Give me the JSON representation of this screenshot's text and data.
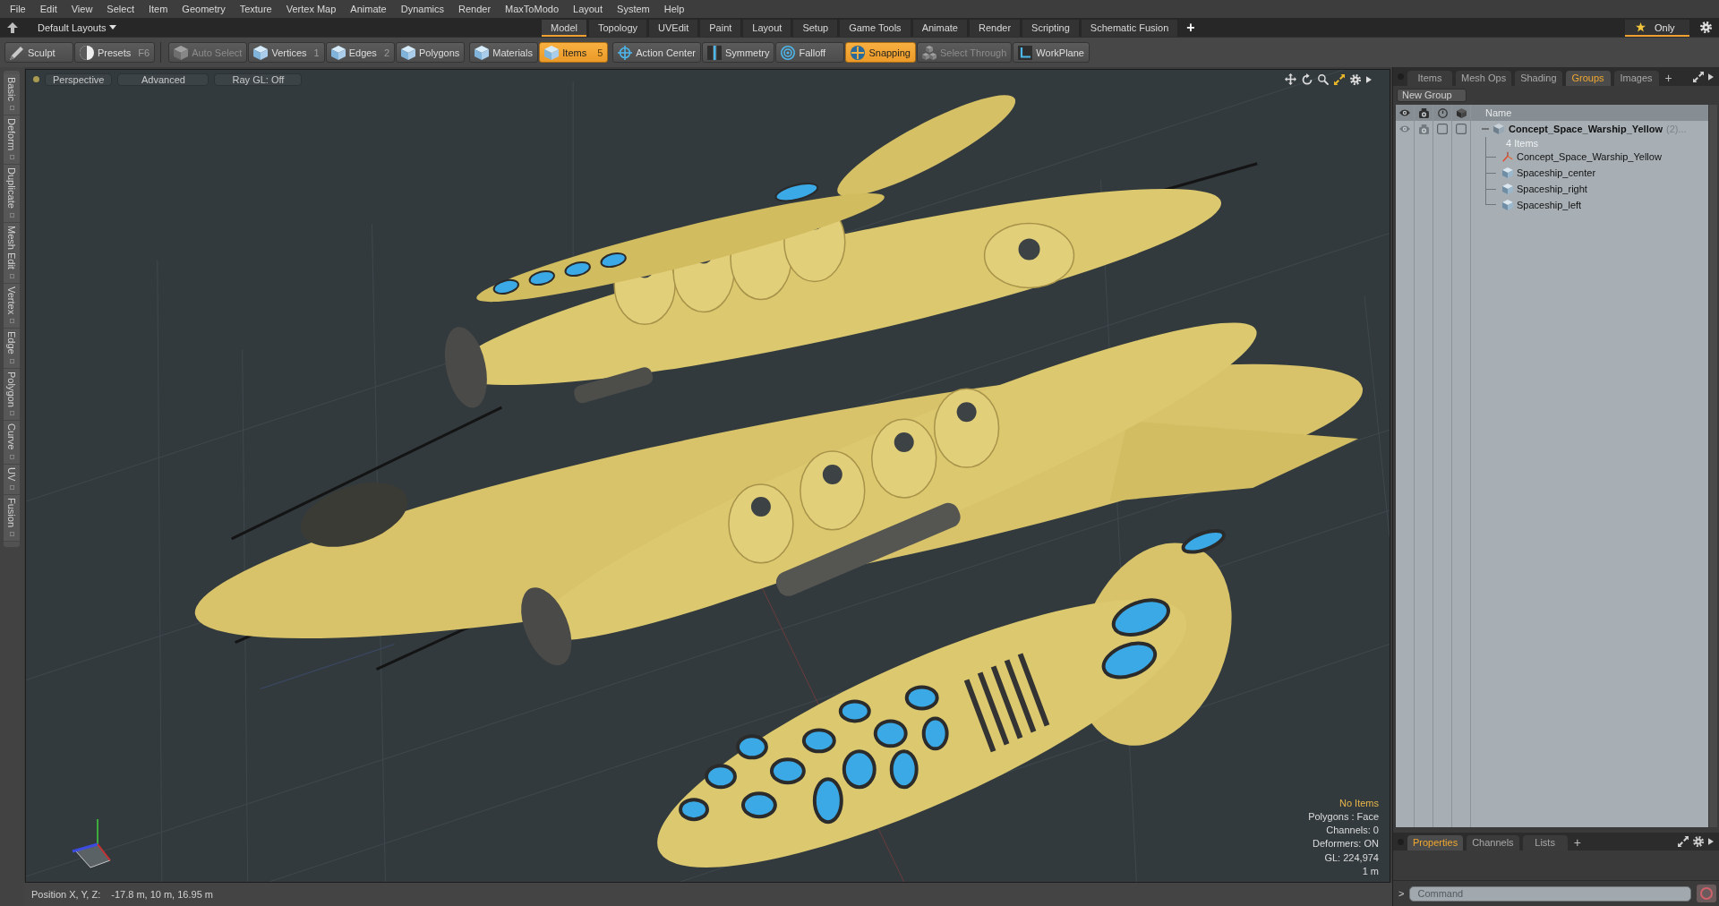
{
  "menu_bar": {
    "items": [
      "File",
      "Edit",
      "View",
      "Select",
      "Item",
      "Geometry",
      "Texture",
      "Vertex Map",
      "Animate",
      "Dynamics",
      "Render",
      "MaxToModo",
      "Layout",
      "System",
      "Help"
    ]
  },
  "layout_bar": {
    "layout_menu": "Default Layouts",
    "tabs": [
      {
        "label": "Model",
        "selected": true
      },
      {
        "label": "Topology",
        "selected": false
      },
      {
        "label": "UVEdit",
        "selected": false
      },
      {
        "label": "Paint",
        "selected": false
      },
      {
        "label": "Layout",
        "selected": false
      },
      {
        "label": "Setup",
        "selected": false
      },
      {
        "label": "Game Tools",
        "selected": false
      },
      {
        "label": "Animate",
        "selected": false
      },
      {
        "label": "Render",
        "selected": false
      },
      {
        "label": "Scripting",
        "selected": false
      },
      {
        "label": "Schematic Fusion",
        "selected": false
      }
    ],
    "add_tab": "+",
    "only_button": "Only"
  },
  "toolbar": {
    "groups": [
      {
        "buttons": [
          {
            "label": "Sculpt",
            "kind": "brush",
            "on": false,
            "disabled": false
          },
          {
            "label": "Presets",
            "shortcut": "F6",
            "kind": "dial",
            "on": false,
            "disabled": false
          }
        ]
      },
      {
        "buttons": [
          {
            "label": "Auto Select",
            "kind": "cube",
            "on": false,
            "disabled": true
          },
          {
            "label": "Vertices",
            "shortcut": "1",
            "kind": "cube",
            "on": false,
            "disabled": false
          },
          {
            "label": "Edges",
            "shortcut": "2",
            "kind": "cube",
            "on": false,
            "disabled": false
          },
          {
            "label": "Polygons",
            "kind": "cube",
            "on": false,
            "disabled": false
          }
        ]
      },
      {
        "buttons": [
          {
            "label": "Materials",
            "kind": "cube",
            "on": false,
            "disabled": false
          },
          {
            "label": "Items",
            "shortcut": "5",
            "kind": "cube",
            "on": true,
            "disabled": false
          }
        ]
      },
      {
        "buttons": [
          {
            "label": "Action Center",
            "kind": "crosshair",
            "on": false,
            "disabled": false
          },
          {
            "label": "Symmetry",
            "kind": "mirror",
            "on": false,
            "disabled": false
          },
          {
            "label": "Falloff",
            "kind": "ring",
            "on": false,
            "disabled": false
          },
          {
            "label": "Snapping",
            "kind": "snap",
            "on": true,
            "disabled": false
          },
          {
            "label": "Select Through",
            "kind": "through",
            "on": false,
            "disabled": true
          },
          {
            "label": "WorkPlane",
            "kind": "plane",
            "on": false,
            "disabled": false
          }
        ]
      }
    ]
  },
  "side_tabs": [
    "Basic",
    "Deform",
    "Duplicate",
    "Mesh Edit",
    "Vertex",
    "Edge",
    "Polygon",
    "Curve",
    "UV",
    "Fusion"
  ],
  "viewport": {
    "header": [
      "Perspective",
      "Advanced",
      "Ray GL: Off"
    ],
    "info": [
      {
        "text": "No Items",
        "kind": "alert"
      },
      {
        "text": "Polygons : Face",
        "kind": "plain"
      },
      {
        "text": "Channels: 0",
        "kind": "plain"
      },
      {
        "text": "Deformers: ON",
        "kind": "plain"
      },
      {
        "text": "GL: 224,974",
        "kind": "plain"
      },
      {
        "text": "1 m",
        "kind": "plain"
      }
    ]
  },
  "status_bar": {
    "label": "Position X, Y, Z:",
    "value": "-17.8 m, 10 m, 16.95 m"
  },
  "right_panel": {
    "tabs": [
      {
        "label": "Items",
        "selected": false
      },
      {
        "label": "Mesh Ops",
        "selected": false
      },
      {
        "label": "Shading",
        "selected": false
      },
      {
        "label": "Groups",
        "selected": true
      },
      {
        "label": "Images",
        "selected": false
      }
    ],
    "add_tab": "+",
    "new_group": "New Group",
    "name_column": "Name",
    "groups": [
      {
        "name": "Concept_Space_Warship_Yellow",
        "suffix": "(2)...",
        "count": "4 Items",
        "expanded": true,
        "column_3": {
          "checked": false
        },
        "column_4": {
          "checked": false
        },
        "children": [
          {
            "name": "Concept_Space_Warship_Yellow",
            "kind": "locator"
          },
          {
            "name": "Spaceship_center",
            "kind": "mesh"
          },
          {
            "name": "Spaceship_right",
            "kind": "mesh"
          },
          {
            "name": "Spaceship_left",
            "kind": "mesh"
          }
        ]
      }
    ]
  },
  "bottom_panel": {
    "tabs": [
      {
        "label": "Properties",
        "selected": true
      },
      {
        "label": "Channels",
        "selected": false
      },
      {
        "label": "Lists",
        "selected": false
      }
    ],
    "add_tab": "+",
    "prompt": ">",
    "command_placeholder": "Command"
  }
}
